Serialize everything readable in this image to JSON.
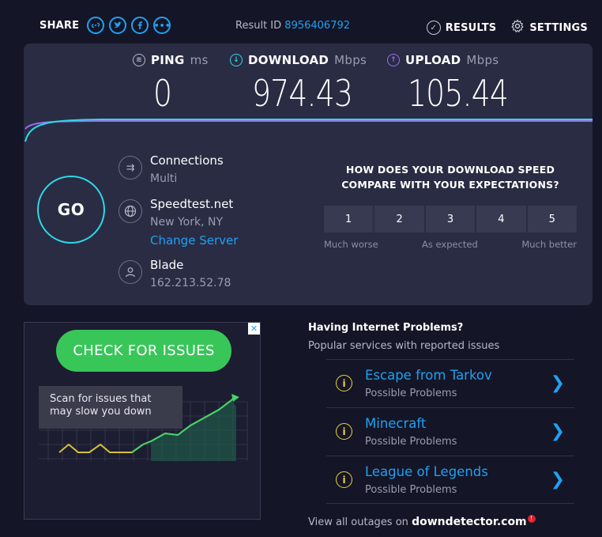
{
  "header": {
    "share_label": "SHARE",
    "share_icons": [
      "link-icon",
      "twitter-icon",
      "facebook-icon",
      "more-icon"
    ],
    "result_prefix": "Result ID",
    "result_id": "8956406792",
    "results_label": "RESULTS",
    "settings_label": "SETTINGS"
  },
  "metrics": {
    "ping": {
      "label": "PING",
      "unit": "ms",
      "value": "0"
    },
    "download": {
      "label": "DOWNLOAD",
      "unit": "Mbps",
      "value": "974.43"
    },
    "upload": {
      "label": "UPLOAD",
      "unit": "Mbps",
      "value": "105.44"
    }
  },
  "go_label": "GO",
  "server": {
    "connections_title": "Connections",
    "connections_value": "Multi",
    "host_title": "Speedtest.net",
    "host_location": "New York, NY",
    "change_server": "Change Server",
    "client_title": "Blade",
    "client_ip": "162.213.52.78"
  },
  "survey": {
    "question": "HOW DOES YOUR DOWNLOAD SPEED COMPARE WITH YOUR EXPECTATIONS?",
    "options": [
      "1",
      "2",
      "3",
      "4",
      "5"
    ],
    "low_label": "Much worse",
    "mid_label": "As expected",
    "high_label": "Much better"
  },
  "ad": {
    "cta": "CHECK FOR ISSUES",
    "tip": "Scan for issues that may slow you down",
    "close": "✕"
  },
  "problems": {
    "heading": "Having Internet Problems?",
    "subheading": "Popular services with reported issues",
    "items": [
      {
        "name": "Escape from Tarkov",
        "status": "Possible Problems"
      },
      {
        "name": "Minecraft",
        "status": "Possible Problems"
      },
      {
        "name": "League of Legends",
        "status": "Possible Problems"
      }
    ],
    "footer_prefix": "View all outages on",
    "footer_brand": "downdetector.com"
  },
  "colors": {
    "background": "#141526",
    "panel": "#2a2c43",
    "accent_blue": "#1fa1f2",
    "download_cyan": "#2bd9e8",
    "upload_purple": "#9b6cf0",
    "cta_green": "#39c659",
    "warning_yellow": "#f2d03b"
  }
}
